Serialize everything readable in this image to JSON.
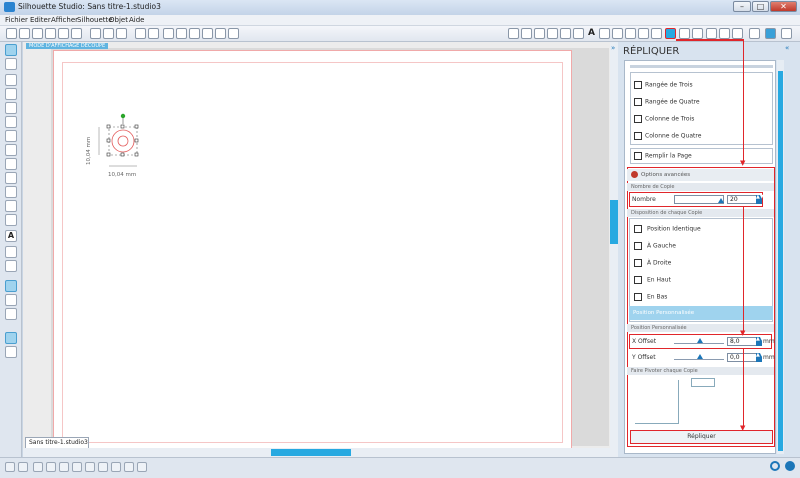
{
  "window": {
    "title": "Silhouette Studio: Sans titre-1.studio3",
    "minimize": "–",
    "maximize": "□",
    "close": "✕"
  },
  "menu": [
    "Fichier",
    "Editer",
    "Afficher",
    "Silhouette",
    "Objet",
    "Aide"
  ],
  "canvas": {
    "mode_badge": "MODE D'AFFICHAGE DÉCOUPE",
    "dim_vertical": "10,04 mm",
    "dim_horizontal": "10,04 mm",
    "doc_tab": "Sans titre-1.studio3"
  },
  "panel": {
    "title": "RÉPLIQUER",
    "replicate_options": [
      "Rangée de Trois",
      "Rangée de Quatre",
      "Colonne de Trois",
      "Colonne de Quatre"
    ],
    "fill_page": "Remplir la Page",
    "advanced_options": "Options avancées",
    "section_copies": "Nombre de Copie",
    "count_label": "Nombre",
    "count_value": "20",
    "section_layout": "Disposition de chaque Copie",
    "positions": [
      "Position Identique",
      "À Gauche",
      "À Droite",
      "En Haut",
      "En Bas"
    ],
    "custom_position": "Position Personnalisée",
    "section_custom": "Position Personnalisée",
    "x_offset_label": "X Offset",
    "x_offset_value": "8,0",
    "y_offset_label": "Y Offset",
    "y_offset_value": "0,0",
    "unit": "mm",
    "section_rotate": "Faire Pivoter chaque Copie",
    "replicate_button": "Répliquer"
  },
  "colors": {
    "accent": "#27a9e1",
    "highlight": "#e0262b",
    "selected": "#9fd3ee"
  }
}
